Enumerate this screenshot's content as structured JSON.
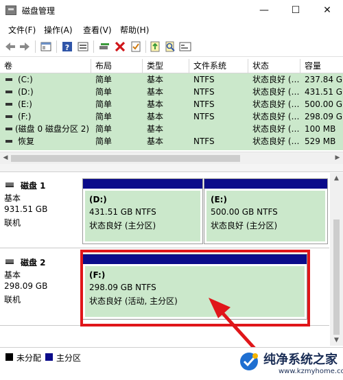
{
  "window": {
    "title": "磁盘管理",
    "minimize": "—",
    "maximize": "☐",
    "close": "✕"
  },
  "menu": [
    "文件(F)",
    "操作(A)",
    "查看(V)",
    "帮助(H)"
  ],
  "toolbar_icons": [
    "back-icon",
    "forward-icon",
    "console-tree-icon",
    "help-icon",
    "view-icon",
    "connect-disk-icon",
    "delete-icon",
    "properties-icon",
    "import-icon",
    "search-icon",
    "format-icon"
  ],
  "volumes": {
    "columns": [
      "卷",
      "布局",
      "类型",
      "文件系统",
      "状态",
      "容量"
    ],
    "rows": [
      {
        "volume": "(C:)",
        "layout": "简单",
        "type": "基本",
        "fs": "NTFS",
        "status": "状态良好 (…",
        "capacity": "237.84 G"
      },
      {
        "volume": "(D:)",
        "layout": "简单",
        "type": "基本",
        "fs": "NTFS",
        "status": "状态良好 (…",
        "capacity": "431.51 G"
      },
      {
        "volume": "(E:)",
        "layout": "简单",
        "type": "基本",
        "fs": "NTFS",
        "status": "状态良好 (…",
        "capacity": "500.00 G"
      },
      {
        "volume": "(F:)",
        "layout": "简单",
        "type": "基本",
        "fs": "NTFS",
        "status": "状态良好 (…",
        "capacity": "298.09 G"
      },
      {
        "volume": "(磁盘 0 磁盘分区 2)",
        "layout": "简单",
        "type": "基本",
        "fs": "",
        "status": "状态良好 (…",
        "capacity": "100 MB"
      },
      {
        "volume": "恢复",
        "layout": "简单",
        "type": "基本",
        "fs": "NTFS",
        "status": "状态良好 (…",
        "capacity": "529 MB"
      }
    ]
  },
  "disks": [
    {
      "name": "磁盘 1",
      "kind": "基本",
      "size": "931.51 GB",
      "state": "联机",
      "partitions": [
        {
          "name": "(D:)",
          "size_fs": "431.51 GB NTFS",
          "status": "状态良好 (主分区)"
        },
        {
          "name": "(E:)",
          "size_fs": "500.00 GB NTFS",
          "status": "状态良好 (主分区)"
        }
      ]
    },
    {
      "name": "磁盘 2",
      "kind": "基本",
      "size": "298.09 GB",
      "state": "联机",
      "partitions": [
        {
          "name": "(F:)",
          "size_fs": "298.09 GB NTFS",
          "status": "状态良好 (活动, 主分区)"
        }
      ]
    }
  ],
  "legend": [
    {
      "label": "未分配",
      "color": "#000000"
    },
    {
      "label": "主分区",
      "color": "#0b0b8a"
    }
  ],
  "colors": {
    "partition_header": "#0b0b8a",
    "healthy_fill": "#cbe8cb",
    "highlight": "#e0161a"
  },
  "watermark": {
    "title": "纯净系统之家",
    "url": "www.kzmyhome.com"
  }
}
